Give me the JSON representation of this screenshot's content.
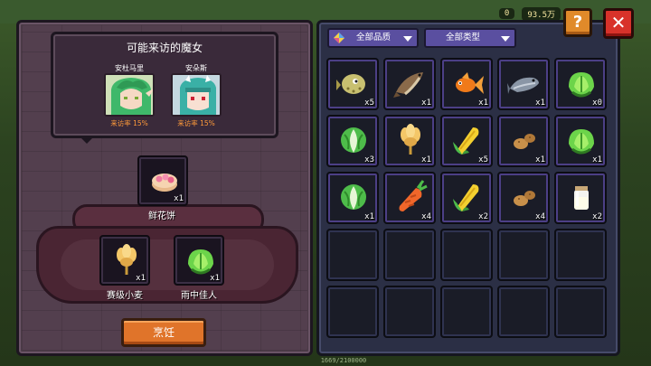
{
  "hud": {
    "chip_1": "0",
    "chip_2": "93.5万",
    "bottom_text": "1669/2100000"
  },
  "witch_panel": {
    "title": "可能来访的魔女",
    "witches": [
      {
        "name": "安杜马里",
        "rate": "来访率 15%",
        "hair_color": "#3fb86a"
      },
      {
        "name": "安朵斯",
        "rate": "来访率 15%",
        "hair_color": "#3ab0a6"
      }
    ]
  },
  "recipe": {
    "result": {
      "label": "鲜花饼",
      "qty": "x1",
      "icon": "flower-cake-icon"
    },
    "ingredients": [
      {
        "label": "赛级小麦",
        "qty": "x1",
        "icon": "wheat-icon"
      },
      {
        "label": "雨中佳人",
        "qty": "x1",
        "icon": "cabbage-icon"
      }
    ],
    "cook_label": "烹饪"
  },
  "filters": {
    "quality_label": "全部品质",
    "type_label": "全部类型"
  },
  "buttons": {
    "help_label": "?",
    "close_label": "✕"
  },
  "inventory": [
    {
      "icon": "pufferfish-icon",
      "qty": "x5"
    },
    {
      "icon": "catfish-icon",
      "qty": "x1"
    },
    {
      "icon": "goldfish-icon",
      "qty": "x1"
    },
    {
      "icon": "grey-fish-icon",
      "qty": "x1"
    },
    {
      "icon": "cabbage-icon",
      "qty": "x0"
    },
    {
      "icon": "bok-choy-icon",
      "qty": "x3"
    },
    {
      "icon": "wheat-icon",
      "qty": "x1"
    },
    {
      "icon": "corn-icon",
      "qty": "x5"
    },
    {
      "icon": "potato-icon",
      "qty": "x1"
    },
    {
      "icon": "cabbage-icon",
      "qty": "x1"
    },
    {
      "icon": "bok-choy-icon",
      "qty": "x1"
    },
    {
      "icon": "carrot-icon",
      "qty": "x4"
    },
    {
      "icon": "corn-icon",
      "qty": "x2"
    },
    {
      "icon": "potato-icon",
      "qty": "x4"
    },
    {
      "icon": "milk-jar-icon",
      "qty": "x2"
    },
    {
      "icon": "",
      "qty": ""
    },
    {
      "icon": "",
      "qty": ""
    },
    {
      "icon": "",
      "qty": ""
    },
    {
      "icon": "",
      "qty": ""
    },
    {
      "icon": "",
      "qty": ""
    },
    {
      "icon": "",
      "qty": ""
    },
    {
      "icon": "",
      "qty": ""
    },
    {
      "icon": "",
      "qty": ""
    },
    {
      "icon": "",
      "qty": ""
    },
    {
      "icon": "",
      "qty": ""
    }
  ]
}
